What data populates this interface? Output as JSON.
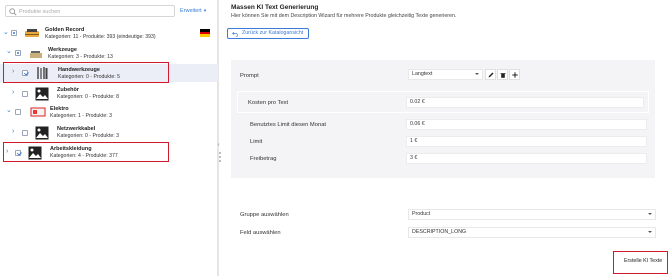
{
  "search": {
    "placeholder": "Produkte suchen"
  },
  "expand_link": "Erweitert",
  "tree": {
    "root": {
      "title": "Golden Record",
      "sub": "Kategorien: 11 - Produkte: 393 (eindeutige: 393)"
    },
    "werkzeuge": {
      "title": "Werkzeuge",
      "sub": "Kategorien: 3 - Produkte: 13"
    },
    "handwerkzeuge": {
      "title": "Handwerkzeuge",
      "sub": "Kategorien: 0 - Produkte: 5"
    },
    "zubehoer": {
      "title": "Zubehör",
      "sub": "Kategorien: 0 - Produkte: 8"
    },
    "elektro": {
      "title": "Elektro",
      "sub": "Kategorien: 1 - Produkte: 3"
    },
    "netzwerkkabel": {
      "title": "Netzwerkkabel",
      "sub": "Kategorien: 0 - Produkte: 3"
    },
    "arbeitskleidung": {
      "title": "Arbeitskleidung",
      "sub": "Kategorien: 4 - Produkte: 377"
    }
  },
  "flag_colors": [
    "#000000",
    "#dd0000",
    "#ffce00"
  ],
  "accent_color": "#3b7bd8",
  "highlight_color": "#d3192b",
  "header": {
    "title": "Massen KI Text Generierung",
    "description": "Hier können Sie mit dem Description Wizard für mehrere Produkte gleichzeitig Texte generieren."
  },
  "back_button": "Zurück zur Katalogansicht",
  "prompt": {
    "label": "Prompt",
    "value": "Langtext"
  },
  "costs": {
    "label": "Kosten pro Text",
    "value": "0.02 €",
    "rows": [
      {
        "label": "Benutztes Limit diesen Monat",
        "value": "0.06 €"
      },
      {
        "label": "Limit",
        "value": "1 €"
      },
      {
        "label": "Freibetrag",
        "value": "3 €"
      }
    ]
  },
  "group": {
    "label": "Gruppe auswählen",
    "value": "Product"
  },
  "field": {
    "label": "Feld auswählen",
    "value": "DESCRIPTION_LONG"
  },
  "generate_button": "Erstelle KI Texte"
}
